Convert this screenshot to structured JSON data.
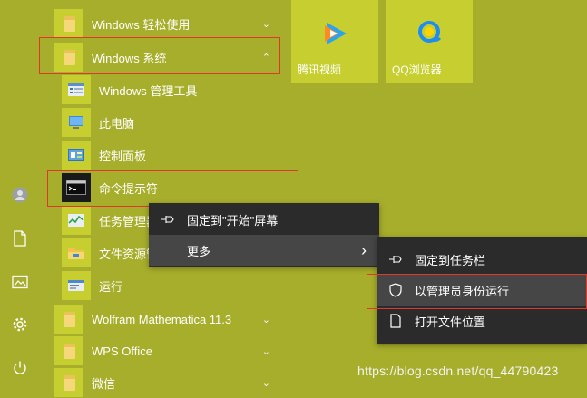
{
  "app_list": {
    "items": [
      {
        "label": "Windows 轻松使用",
        "chevron": "⌄"
      },
      {
        "label": "Windows 系统",
        "chevron": "⌃"
      },
      {
        "label": "Windows 管理工具"
      },
      {
        "label": "此电脑"
      },
      {
        "label": "控制面板"
      },
      {
        "label": "命令提示符"
      },
      {
        "label": "任务管理器"
      },
      {
        "label": "文件资源管理器"
      },
      {
        "label": "运行"
      },
      {
        "label": "Wolfram Mathematica 11.3",
        "chevron": "⌄"
      },
      {
        "label": "WPS Office",
        "chevron": "⌄"
      },
      {
        "label": "微信",
        "chevron": "⌄"
      }
    ]
  },
  "tiles": [
    {
      "label": "腾讯视频",
      "icon": "tencent-video-icon"
    },
    {
      "label": "QQ浏览器",
      "icon": "qq-browser-icon"
    }
  ],
  "context_menu": {
    "pin_start": "固定到\"开始\"屏幕",
    "more": "更多",
    "more_arrow": "›"
  },
  "submenu": {
    "pin_taskbar": "固定到任务栏",
    "run_as_admin": "以管理员身份运行",
    "open_location": "打开文件位置"
  },
  "watermark": "https://blog.csdn.net/qq_44790423",
  "colors": {
    "background": "#a7ae2b",
    "tile": "#c6cf2f",
    "menu": "#2b2b2b",
    "highlight": "#e0382b"
  }
}
